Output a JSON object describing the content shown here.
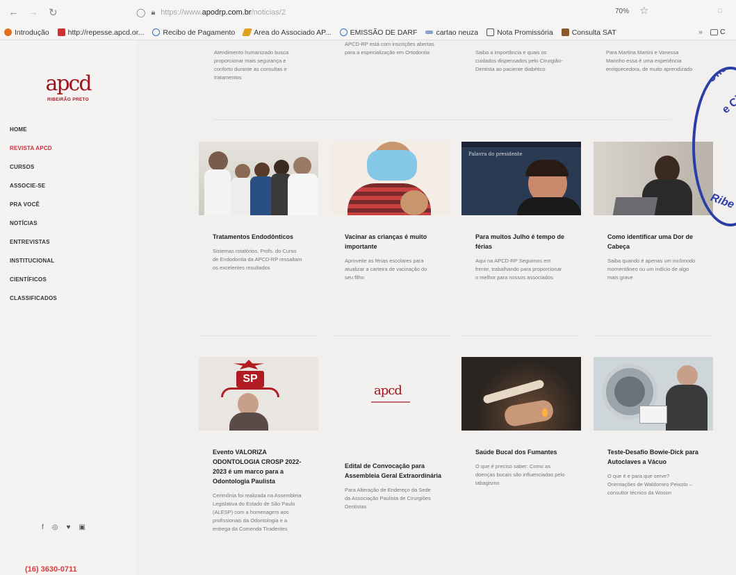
{
  "browser": {
    "url_prefix": "https://www.",
    "url_host": "apodrp.com.br",
    "url_path": "/noticias/2",
    "zoom": "70%"
  },
  "bookmarks": [
    {
      "label": "Introdução",
      "color": "#e07020"
    },
    {
      "label": "http://repesse.apcd.or...",
      "color": "#d23030"
    },
    {
      "label": "Recibo de Pagamento",
      "color": "#2a6fd0"
    },
    {
      "label": "Area do Associado AP...",
      "color": "#e0a020"
    },
    {
      "label": "EMISSÃO DE DARF",
      "color": "#2a6fd0"
    },
    {
      "label": "cartao neuza",
      "color": "#8aa0c8"
    },
    {
      "label": "Nota Promissória",
      "color": "#555555"
    },
    {
      "label": "Consulta SAT",
      "color": "#8a5a2a"
    }
  ],
  "bookmarks_overflow": "»",
  "bookmarks_folder": "C",
  "sidebar": {
    "logo_text": "apcd",
    "logo_sub": "RIBEIRÃO PRETO",
    "menu": [
      "HOME",
      "REVISTA APCD",
      "CURSOS",
      "ASSOCIE-SE",
      "PRA VOCÊ",
      "NOTÍCIAS",
      "ENTREVISTAS",
      "INSTITUCIONAL",
      "CIENTÍFICOS",
      "CLASSIFICADOS"
    ],
    "active_index": 1,
    "social": [
      "f",
      "◎",
      "♥",
      "▣"
    ],
    "phone": "(16) 3630-0711"
  },
  "top_row": [
    "Atendimento humanizado busca proporcionar mais segurança e conforto durante as consultas e tratamentos",
    "APCD-RP está com inscrições abertas para a especialização em Ortodontia",
    "Saiba a importância e quais os cuidados dispensados pelo Cirurgião-Dentista ao paciente diabético",
    "Para Martina Martini e Vanessa Marinho essa é uma experiência enriquecedora, de muito aprendizado"
  ],
  "row2": [
    {
      "title": "Tratamentos Endodônticos",
      "desc": "Sistemas rotatórios, Profs. do Curso de Endodontia da APCD-RP ressaltam os excelentes resultados"
    },
    {
      "title": "Vacinar as crianças é muito importante",
      "desc": "Aproveite as férias escolares para atualizar a carteira de vacinação do seu filho"
    },
    {
      "title": "Para muitos Julho é tempo de férias",
      "desc": "Aqui na APCD-RP Seguimos em frente, trabalhando para proporcionar o melhor para nossos associados",
      "image_caption": "Palavra do presidente"
    },
    {
      "title": "Como identificar uma Dor de Cabeça",
      "desc": "Saiba quando é apenas um incômodo momentâneo ou um indício de algo mais grave"
    }
  ],
  "row3": [
    {
      "title": "Evento VALORIZA ODONTOLOGIA CROSP 2022-2023 é um marco para a Odontologia Paulista",
      "desc": "Cerimônia foi realizada na Assembleia Legislativa do Estado de São Paulo (ALESP) com a homenagem aos profissionais da Odontologia e a entrega da Comenda Tiradentes",
      "image_text": "SP"
    },
    {
      "title": "Edital de Convocação para Assembleia Geral Extraordinária",
      "desc": "Para Alteração de Endereço da Sede da Associação Paulista de Cirurgiões Dentistas",
      "image_logo": "apcd"
    },
    {
      "title": "Saúde Bucal dos Fumantes",
      "desc": "O que é preciso saber: Como as doenças bucais são influenciadas pelo tabagismo"
    },
    {
      "title": "Teste-Desafio Bowie-Dick para Autoclaves a Vácuo",
      "desc": "O que é e para que serve? Orientações de Waldomiro Peixoto – consultor técnico da Woson"
    }
  ],
  "stamp_text": [
    "Oficial de Registro",
    "e Civil d",
    "Ribe"
  ]
}
